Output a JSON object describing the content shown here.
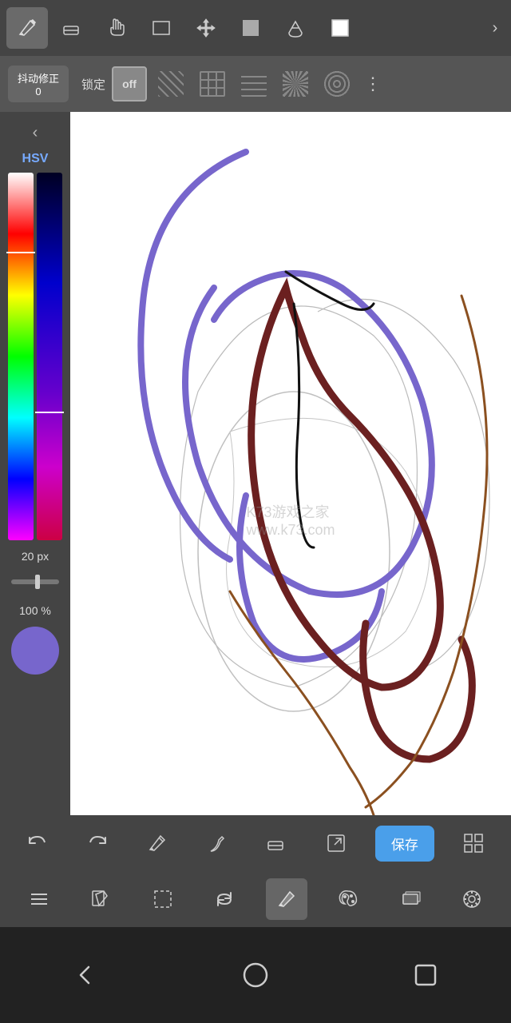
{
  "topToolbar": {
    "tools": [
      {
        "name": "pen",
        "icon": "✏️",
        "active": true
      },
      {
        "name": "eraser",
        "icon": "⬜"
      },
      {
        "name": "hand",
        "icon": "✋"
      },
      {
        "name": "rectangle",
        "icon": "▭"
      },
      {
        "name": "move",
        "icon": "✢"
      },
      {
        "name": "fill-rect",
        "icon": "■"
      },
      {
        "name": "fill-bucket",
        "icon": "◈"
      },
      {
        "name": "color-picker",
        "icon": "□"
      }
    ],
    "expand": "›"
  },
  "stabilizerBar": {
    "btnLabel": "抖动修正\n0",
    "lockLabel": "锁定",
    "offLabel": "off",
    "moreIcon": "⋮"
  },
  "leftPanel": {
    "collapseIcon": "‹",
    "hsvLabel": "HSV",
    "sizeLabel": "20 px",
    "opacityLabel": "100 %",
    "colorPreview": "#7766cc"
  },
  "watermark": "K73游戏之家\nwww.k73.com",
  "bottomToolbar1": {
    "undoLabel": "↩",
    "redoLabel": "↪",
    "pencilLabel": "✏",
    "penLabel": "🖊",
    "eraserLabel": "◻",
    "exportLabel": "↗",
    "saveLabel": "保存",
    "gridLabel": "⊞"
  },
  "bottomToolbar2": {
    "menuLabel": "≡",
    "editLabel": "✎",
    "selectLabel": "⬚",
    "rotateLabel": "↺",
    "drawLabel": "✏",
    "paletteLabel": "🎨",
    "layersLabel": "⊡",
    "settingsLabel": "⊕"
  },
  "navBar": {
    "backLabel": "◁",
    "homeLabel": "○",
    "recentLabel": "□"
  }
}
